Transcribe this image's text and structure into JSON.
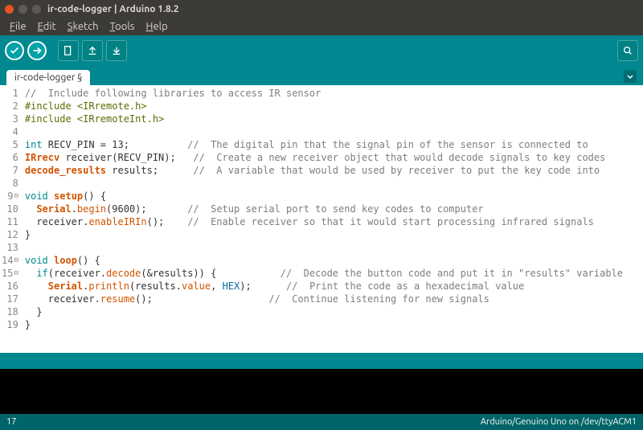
{
  "window": {
    "title": "ir-code-logger | Arduino 1.8.2"
  },
  "menu": {
    "file": "File",
    "edit": "Edit",
    "sketch": "Sketch",
    "tools": "Tools",
    "help": "Help"
  },
  "tab": {
    "name": "ir-code-logger §"
  },
  "footer": {
    "line": "17",
    "board": "Arduino/Genuino Uno on /dev/ttyACM1"
  },
  "code": [
    {
      "n": "1",
      "t": [
        [
          "c-comment",
          "//  Include following libraries to access IR sensor"
        ]
      ]
    },
    {
      "n": "2",
      "t": [
        [
          "c-preproc",
          "#include <IRremote.h>"
        ]
      ]
    },
    {
      "n": "3",
      "t": [
        [
          "c-preproc",
          "#include <IRremoteInt.h>"
        ]
      ]
    },
    {
      "n": "4",
      "t": [
        [
          "",
          ""
        ]
      ]
    },
    {
      "n": "5",
      "t": [
        [
          "c-type",
          "int"
        ],
        [
          "",
          " RECV_PIN = 13;          "
        ],
        [
          "c-comment",
          "//  The digital pin that the signal pin of the sensor is connected to"
        ]
      ]
    },
    {
      "n": "6",
      "t": [
        [
          "c-orange",
          "IRrecv"
        ],
        [
          "",
          " receiver(RECV_PIN);   "
        ],
        [
          "c-comment",
          "//  Create a new receiver object that would decode signals to key codes"
        ]
      ]
    },
    {
      "n": "7",
      "t": [
        [
          "c-orange",
          "decode_results"
        ],
        [
          "",
          " results;      "
        ],
        [
          "c-comment",
          "//  A variable that would be used by receiver to put the key code into"
        ]
      ]
    },
    {
      "n": "8",
      "t": [
        [
          "",
          ""
        ]
      ]
    },
    {
      "n": "9",
      "f": true,
      "t": [
        [
          "c-type",
          "void"
        ],
        [
          "",
          " "
        ],
        [
          "c-orange",
          "setup"
        ],
        [
          "",
          "() {"
        ]
      ]
    },
    {
      "n": "10",
      "t": [
        [
          "",
          "  "
        ],
        [
          "c-orange",
          "Serial"
        ],
        [
          "",
          "."
        ],
        [
          "c-func",
          "begin"
        ],
        [
          "",
          "(9600);       "
        ],
        [
          "c-comment",
          "//  Setup serial port to send key codes to computer"
        ]
      ]
    },
    {
      "n": "11",
      "t": [
        [
          "",
          "  receiver."
        ],
        [
          "c-func",
          "enableIRIn"
        ],
        [
          "",
          "();    "
        ],
        [
          "c-comment",
          "//  Enable receiver so that it would start processing infrared signals"
        ]
      ]
    },
    {
      "n": "12",
      "t": [
        [
          "",
          "}"
        ]
      ]
    },
    {
      "n": "13",
      "t": [
        [
          "",
          ""
        ]
      ]
    },
    {
      "n": "14",
      "f": true,
      "t": [
        [
          "c-type",
          "void"
        ],
        [
          "",
          " "
        ],
        [
          "c-orange",
          "loop"
        ],
        [
          "",
          "() {"
        ]
      ]
    },
    {
      "n": "15",
      "f": true,
      "t": [
        [
          "",
          "  "
        ],
        [
          "c-type",
          "if"
        ],
        [
          "",
          "(receiver."
        ],
        [
          "c-func",
          "decode"
        ],
        [
          "",
          "(&results)) {           "
        ],
        [
          "c-comment",
          "//  Decode the button code and put it in \"results\" variable"
        ]
      ]
    },
    {
      "n": "16",
      "t": [
        [
          "",
          "    "
        ],
        [
          "c-orange",
          "Serial"
        ],
        [
          "",
          "."
        ],
        [
          "c-func",
          "println"
        ],
        [
          "",
          "(results."
        ],
        [
          "c-func",
          "value"
        ],
        [
          "",
          ", "
        ],
        [
          "c-blue",
          "HEX"
        ],
        [
          "",
          ");      "
        ],
        [
          "c-comment",
          "//  Print the code as a hexadecimal value"
        ]
      ]
    },
    {
      "n": "17",
      "t": [
        [
          "",
          "    receiver."
        ],
        [
          "c-func",
          "resume"
        ],
        [
          "",
          "();                    "
        ],
        [
          "c-comment",
          "//  Continue listening for new signals"
        ]
      ]
    },
    {
      "n": "18",
      "t": [
        [
          "",
          "  }"
        ]
      ]
    },
    {
      "n": "19",
      "t": [
        [
          "",
          "}"
        ]
      ]
    }
  ]
}
